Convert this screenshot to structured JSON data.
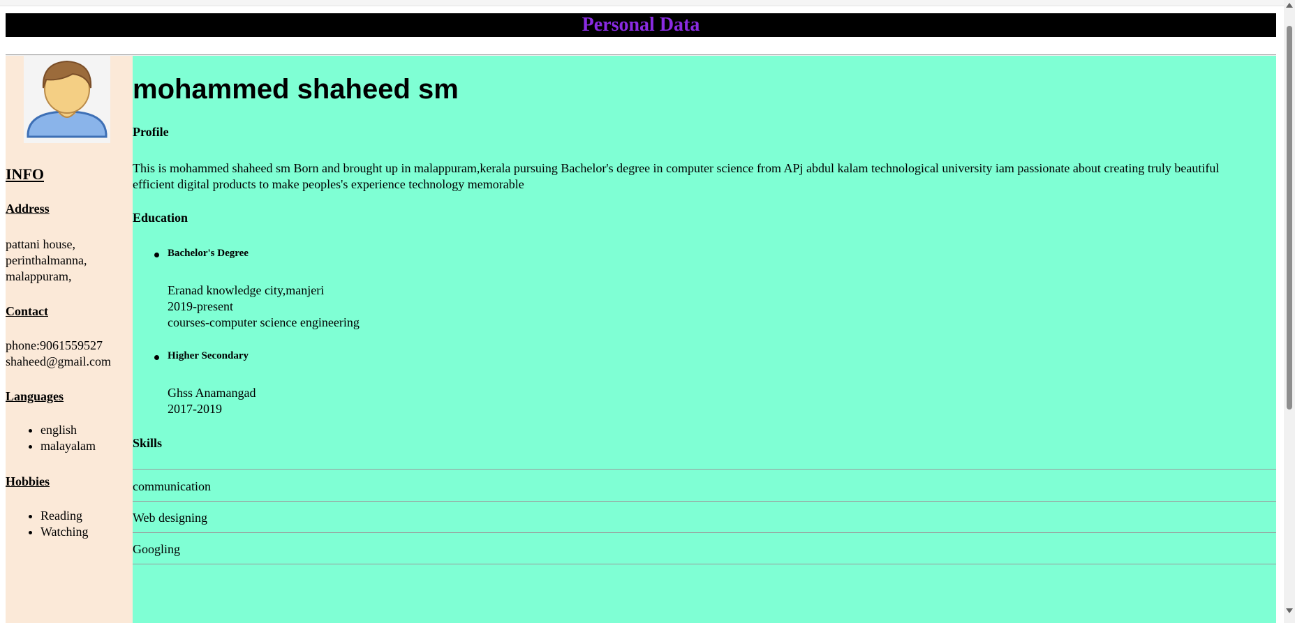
{
  "header": {
    "title": "Personal Data"
  },
  "sidebar": {
    "info_heading": "INFO",
    "address_heading": "Address",
    "address_lines": [
      "pattani house,",
      "perinthalmanna,",
      "malappuram,"
    ],
    "contact_heading": "Contact",
    "contact_lines": [
      "phone:9061559527",
      "shaheed@gmail.com"
    ],
    "languages_heading": "Languages",
    "languages": [
      "english",
      "malayalam"
    ],
    "hobbies_heading": "Hobbies",
    "hobbies": [
      "Reading",
      "Watching"
    ]
  },
  "main": {
    "name": "mohammed shaheed sm",
    "profile_heading": "Profile",
    "profile_text": "This is mohammed shaheed sm Born and brought up in malappuram,kerala pursuing Bachelor's degree in computer science from APj abdul kalam technological university iam passionate about creating truly beautiful efficient digital products to make peoples's experience technology memorable",
    "education_heading": "Education",
    "education": [
      {
        "title": "Bachelor's Degree",
        "lines": [
          "Eranad knowledge city,manjeri",
          "2019-present",
          "courses-computer science engineering"
        ]
      },
      {
        "title": "Higher Secondary",
        "lines": [
          "Ghss Anamangad",
          "2017-2019"
        ]
      }
    ],
    "skills_heading": "Skills",
    "skills": [
      "communication",
      "Web designing",
      "Googling"
    ]
  },
  "colors": {
    "header_bg": "#000000",
    "header_text": "#8a2be2",
    "sidebar_bg": "#fbe9d8",
    "main_bg": "#7fffd4"
  },
  "icons": {
    "avatar": "user-avatar-icon"
  }
}
